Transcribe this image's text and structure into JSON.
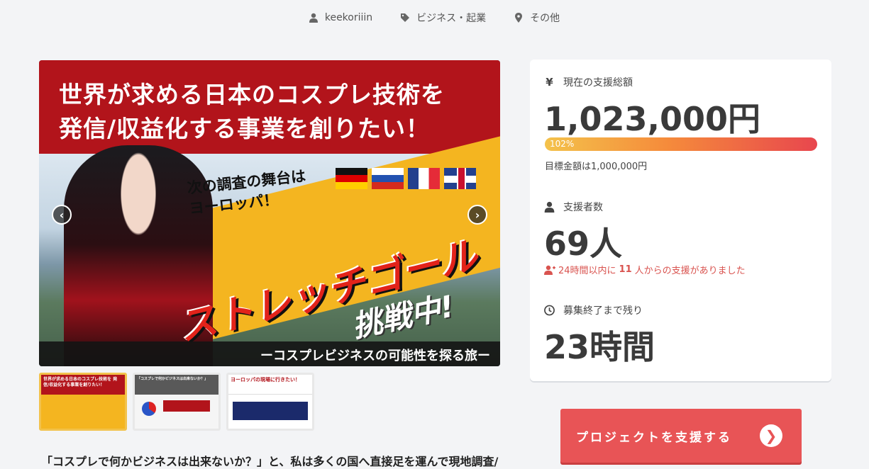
{
  "meta": {
    "owner": "keekoriiin",
    "category": "ビジネス・起業",
    "location": "その他"
  },
  "hero": {
    "title_line1": "世界が求める日本のコスプレ技術を",
    "title_line2": "発信/収益化する事業を創りたい！",
    "callout": "次の調査の舞台は\nヨーロッパ！",
    "big_text": "ストレッチゴール",
    "challenge": "挑戦中!",
    "tagline": "ーコスプレビジネスの可能性を探る旅ー",
    "flags": [
      "de-flag",
      "ru-flag",
      "fr-flag",
      "uk-flag"
    ]
  },
  "thumbs": [
    {
      "head": "世界が求める日本のコスプレ技術を 発信/収益化する事業を創りたい！"
    },
    {
      "head": "「コスプレで何かビジネスは出来ないか？」"
    },
    {
      "head": "ヨーロッパの現場に行きたい！"
    }
  ],
  "description": "「コスプレで何かビジネスは出来ないか？」と、私は多くの国へ直接足を運んで現地調査/",
  "stats": {
    "total_label": "現在の支援総額",
    "total_value": "1,023,000円",
    "progress_text": "102%",
    "progress_pct": 102,
    "goal_text": "目標金額は1,000,000円",
    "backers_label": "支援者数",
    "backers_value": "69人",
    "recent_prefix": "24時間以内に",
    "recent_count": "11",
    "recent_suffix": "人からの支援がありました",
    "remaining_label": "募集終了まで残り",
    "remaining_value": "23時間"
  },
  "support_button": "プロジェクトを支援する",
  "colors": {
    "accent": "#e85456",
    "hero_red": "#b2141b",
    "progress_start": "#f4c24b",
    "progress_end": "#e8464e"
  }
}
